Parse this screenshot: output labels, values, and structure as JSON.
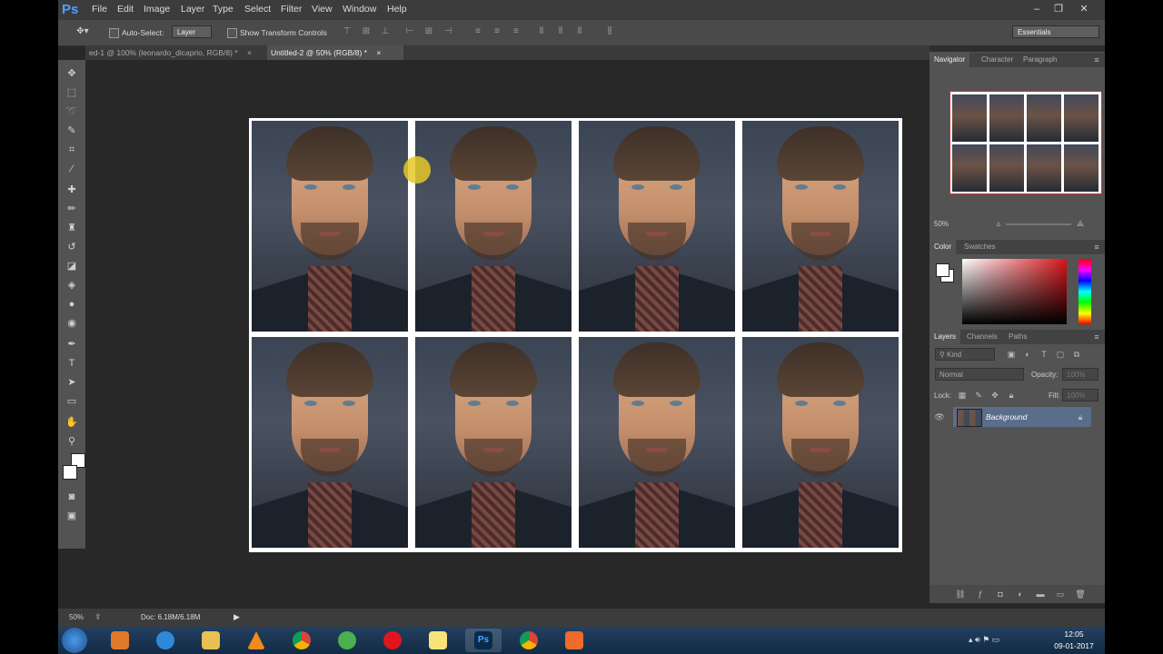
{
  "app": {
    "logo": "Ps",
    "menu": [
      "File",
      "Edit",
      "Image",
      "Layer",
      "Type",
      "Select",
      "Filter",
      "View",
      "Window",
      "Help"
    ],
    "window_controls": {
      "minimize": "–",
      "restore": "❐",
      "close": "✕"
    }
  },
  "options": {
    "auto_select_label": "Auto-Select:",
    "auto_select_value": "Layer",
    "show_transform_label": "Show Transform Controls",
    "workspace": "Essentials"
  },
  "tabs": [
    {
      "label": "ed-1 @ 100% (leonardo_dicaprio, RGB/8) *",
      "close": "×",
      "active": false
    },
    {
      "label": "Untitled-2 @ 50% (RGB/8) *",
      "close": "×",
      "active": true
    }
  ],
  "navigator": {
    "tabs": [
      "Navigator",
      "Character",
      "Paragraph"
    ],
    "zoom": "50%"
  },
  "color_panel": {
    "tabs": [
      "Color",
      "Swatches"
    ],
    "foreground": "#ffffff",
    "background": "#ffffff"
  },
  "layers_panel": {
    "tabs": [
      "Layers",
      "Channels",
      "Paths"
    ],
    "kind_filter": "Kind",
    "blend_mode": "Normal",
    "opacity_label": "Opacity:",
    "opacity_value": "100%",
    "lock_label": "Lock:",
    "fill_label": "Fill:",
    "fill_value": "100%",
    "layers": [
      {
        "name": "Background",
        "visible": true,
        "locked": true
      }
    ]
  },
  "status": {
    "zoom": "50%",
    "doc": "Doc: 6.18M/6.18M"
  },
  "taskbar": {
    "time": "12:05",
    "date": "09-01-2017"
  },
  "canvas": {
    "grid_rows": 2,
    "grid_cols": 4
  }
}
